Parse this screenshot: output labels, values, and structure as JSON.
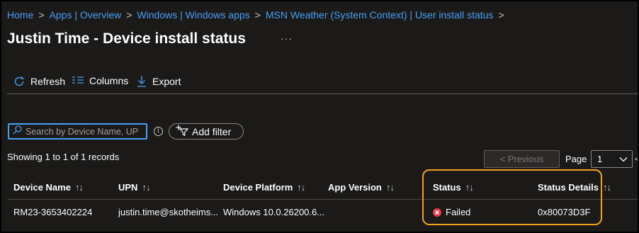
{
  "breadcrumb": [
    "Home",
    "Apps | Overview",
    "Windows | Windows apps",
    "MSN Weather (System Context) | User install status"
  ],
  "page_title": "Justin Time - Device install status",
  "more_label": "···",
  "toolbar": {
    "refresh": "Refresh",
    "columns": "Columns",
    "export": "Export"
  },
  "search": {
    "placeholder": "Search by Device Name, UPN",
    "value": ""
  },
  "info_glyph": "i",
  "add_filter": "Add filter",
  "records_text": "Showing 1 to 1 of 1 records",
  "pagination": {
    "previous": "< Previous",
    "page_label": "Page",
    "page_value": "1",
    "next_cut": "<"
  },
  "table": {
    "sort_glyph": "↑↓",
    "columns": [
      "Device Name",
      "UPN",
      "Device Platform",
      "App Version",
      "Status",
      "Status Details"
    ],
    "rows": [
      {
        "device_name": "RM23-3653402224",
        "upn": "justin.time@skotheims...",
        "device_platform": "Windows 10.0.26200.6...",
        "app_version": "",
        "status": "Failed",
        "status_details": "0x80073D3F"
      }
    ]
  },
  "colors": {
    "background": "#1b1a19",
    "link": "#479ef5",
    "highlight": "#f0a21c",
    "failed": "#e8394d"
  },
  "icons": [
    "refresh-icon",
    "columns-icon",
    "export-icon",
    "search-icon",
    "info-icon",
    "add-filter-icon",
    "chevron-down-icon",
    "failed-icon"
  ]
}
